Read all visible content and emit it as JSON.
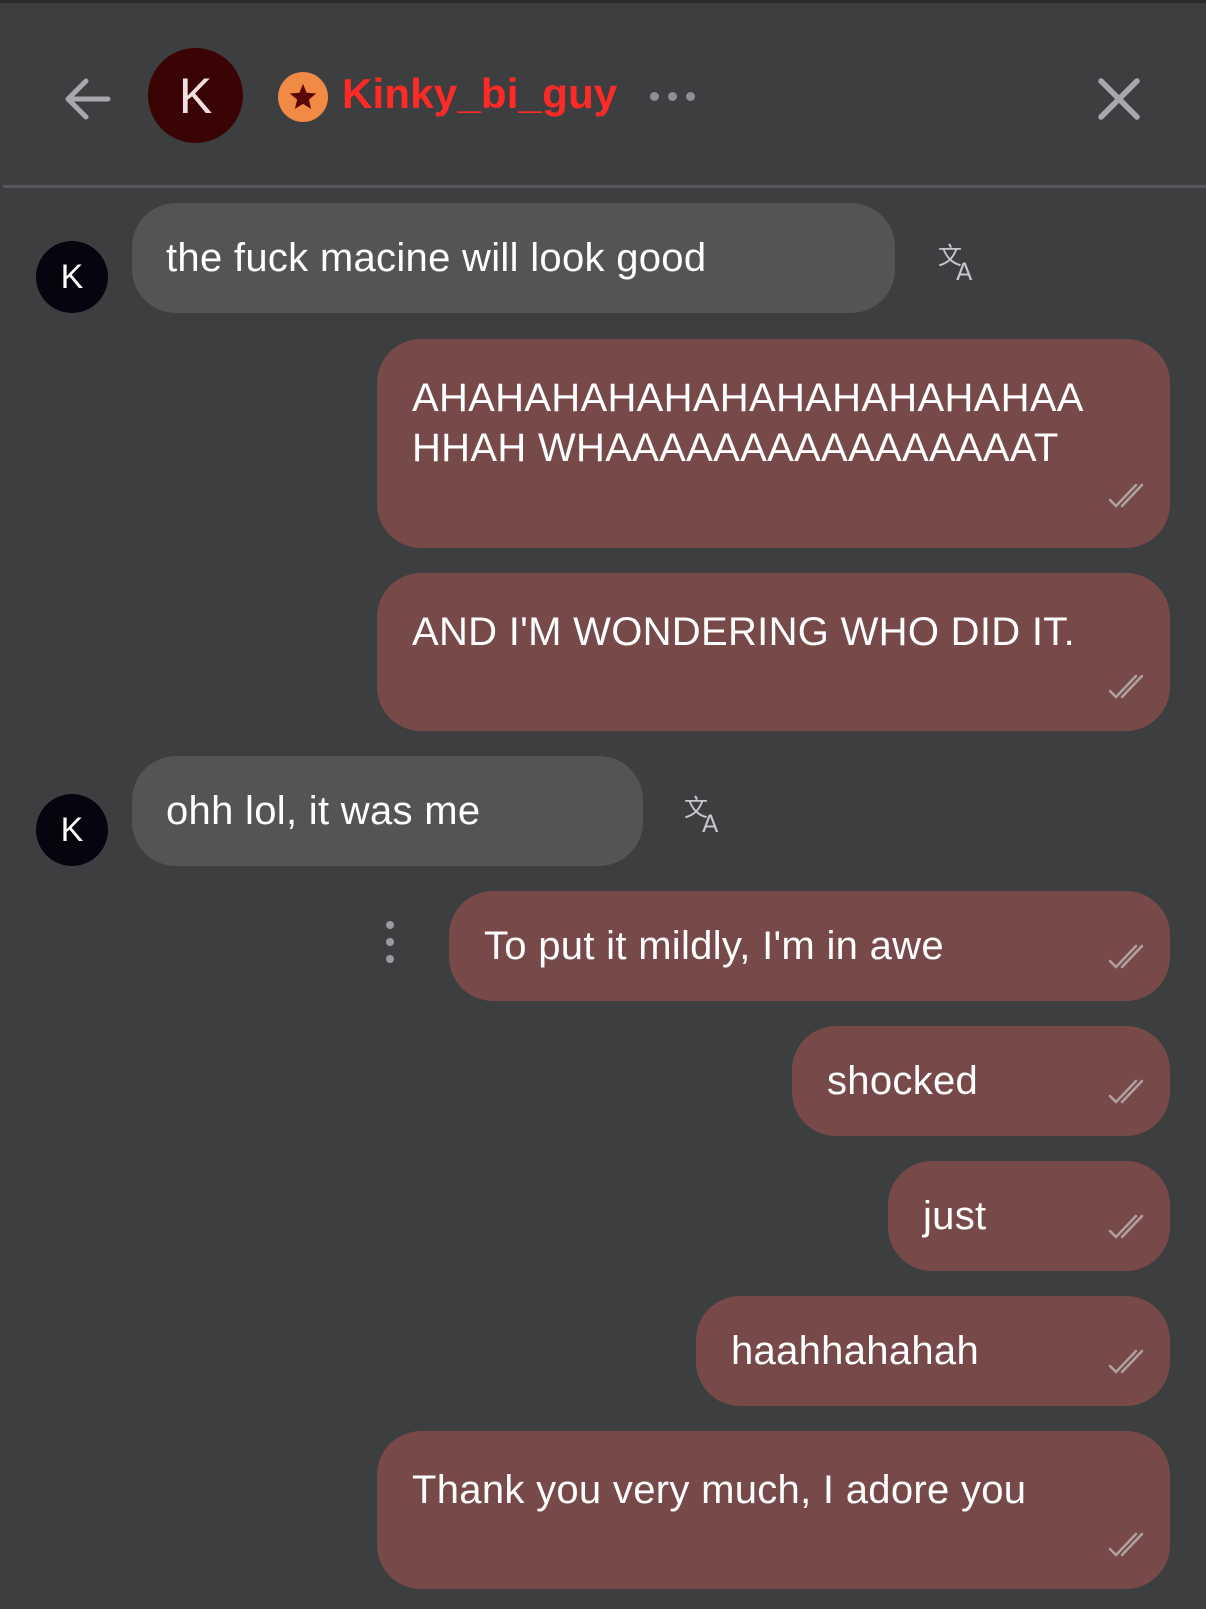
{
  "header": {
    "avatar_letter": "K",
    "username": "Kinky_bi_guy",
    "username_color": "#ff2a26",
    "icons": [
      "back-arrow-icon",
      "star-badge-icon",
      "more-dots-icon",
      "close-icon"
    ]
  },
  "messages": [
    {
      "direction": "incoming",
      "avatar_letter": "K",
      "text": "the fuck macine will look good"
    },
    {
      "direction": "outgoing",
      "lines": [
        "AHAHAHAHAHAHAHAHAHAHAHAA",
        "HHAH WHAAAAAAAAAAAAAAAAT"
      ],
      "status": "read"
    },
    {
      "direction": "outgoing",
      "text": "AND I'M WONDERING WHO DID IT.",
      "status": "read"
    },
    {
      "direction": "incoming",
      "avatar_letter": "K",
      "text": "ohh lol, it was me"
    },
    {
      "direction": "outgoing",
      "text": "To put it mildly, I'm in awe",
      "status": "read"
    },
    {
      "direction": "outgoing",
      "text": "shocked",
      "status": "read"
    },
    {
      "direction": "outgoing",
      "text": "just",
      "status": "read"
    },
    {
      "direction": "outgoing",
      "text": "haahhahahah",
      "status": "read"
    },
    {
      "direction": "outgoing",
      "text": "Thank you very much, I adore you",
      "status": "read"
    }
  ],
  "colors": {
    "background": "#3d3e40",
    "incoming_bubble": "#535456",
    "outgoing_bubble": "#774949",
    "avatar_large": "#3a0404",
    "badge": "#f08a44"
  }
}
